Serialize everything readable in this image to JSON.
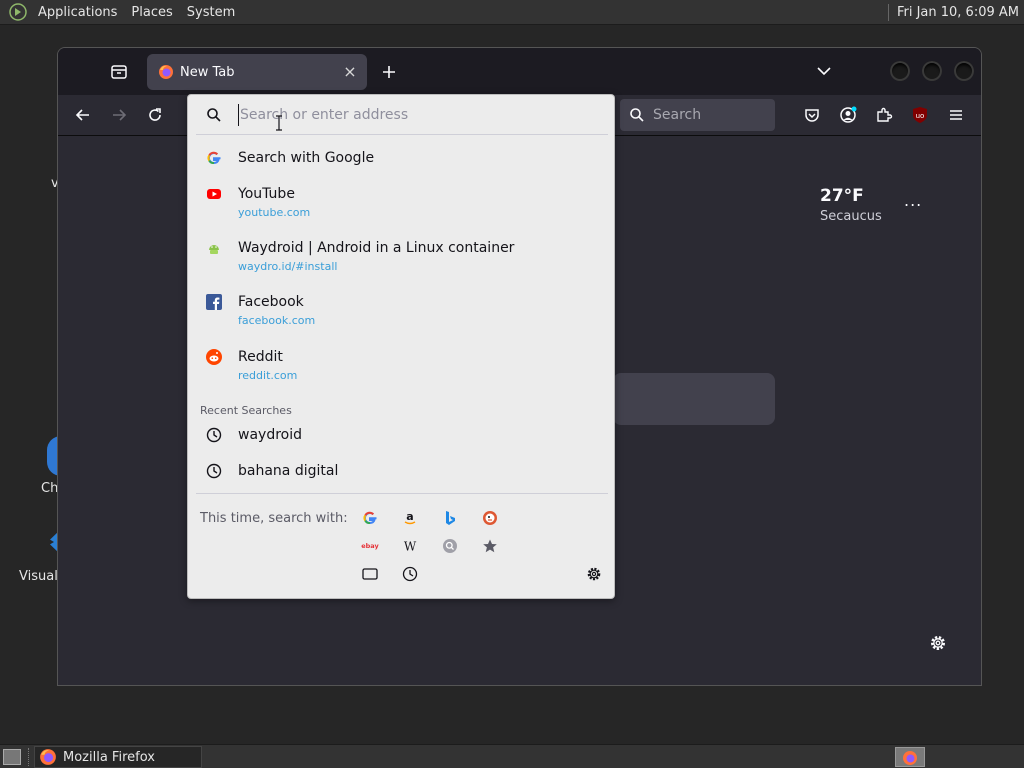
{
  "top_panel": {
    "menus": [
      "Applications",
      "Places",
      "System"
    ],
    "clock": "Fri Jan 10,  6:09 AM"
  },
  "desktop": {
    "partial_labels": [
      "v",
      "Ch",
      "Visual"
    ]
  },
  "browser": {
    "tab": {
      "title": "New Tab"
    },
    "toolbar_search_placeholder": "Search",
    "weather": {
      "temp": "27°F",
      "location": "Secaucus",
      "menu": "..."
    }
  },
  "urlbar": {
    "placeholder": "Search or enter address",
    "value": "",
    "results": [
      {
        "title": "Search with Google",
        "url": "",
        "icon": "google-icon"
      },
      {
        "title": "YouTube",
        "url": "youtube.com",
        "icon": "youtube-icon"
      },
      {
        "title": "Waydroid | Android in a Linux container",
        "url": "waydro.id/#install",
        "icon": "waydroid-icon"
      },
      {
        "title": "Facebook",
        "url": "facebook.com",
        "icon": "facebook-icon"
      },
      {
        "title": "Reddit",
        "url": "reddit.com",
        "icon": "reddit-icon"
      }
    ],
    "recent_label": "Recent Searches",
    "recent": [
      "waydroid",
      "bahana digital"
    ],
    "oneoff_label": "This time, search with:",
    "oneoff_engines": [
      "google-icon",
      "amazon-icon",
      "bing-icon",
      "duckduckgo-icon",
      "ebay-icon",
      "wikipedia-icon",
      "search-engine-icon",
      "bookmarks-icon",
      "tabs-icon",
      "history-icon"
    ],
    "ebay_text": "ebay",
    "wiki_text": "W"
  },
  "taskbar": {
    "window_label": "Mozilla Firefox"
  },
  "colors": {
    "desktop_bg": "#262626",
    "panel_bg": "#333333",
    "ff_bg": "#2b2a33",
    "popup_bg": "#ececec",
    "link": "#3a9ed8"
  }
}
